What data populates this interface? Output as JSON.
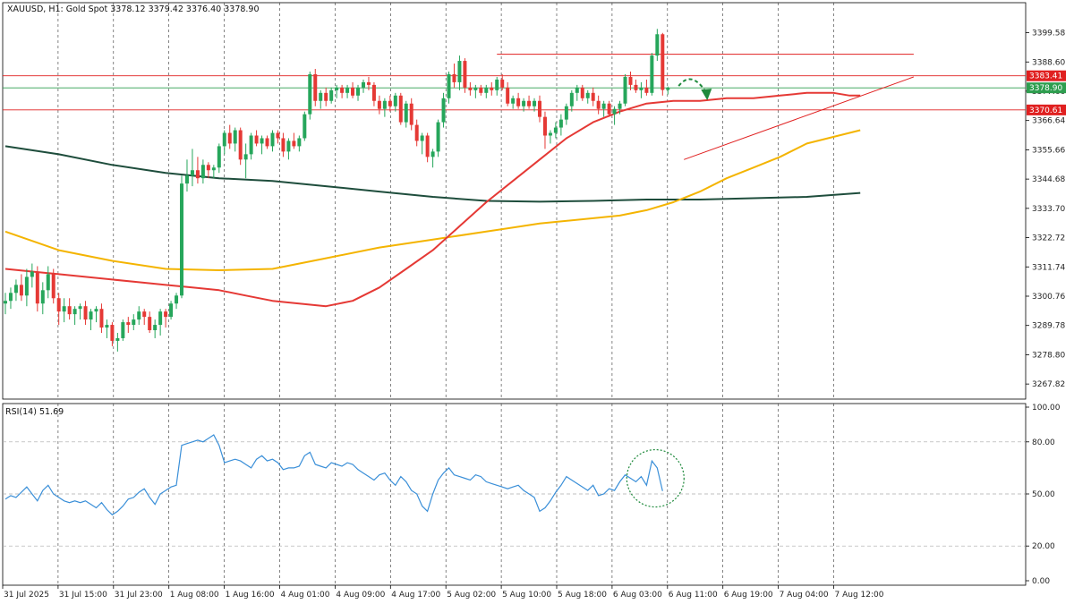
{
  "header": {
    "symbol": "XAUUSD",
    "timeframe": "H1",
    "description": "Gold Spot",
    "ohlc": [
      "3378.12",
      "3379.42",
      "3376.40",
      "3378.90"
    ]
  },
  "rsi_header": {
    "label": "RSI(14)",
    "value": "51.69"
  },
  "colors": {
    "bull": "#26a65b",
    "bear": "#e53935",
    "ma_fast": "#e53935",
    "ma_mid": "#f4b400",
    "ma_slow": "#1e4d3c",
    "rsi": "#3a8fd8",
    "level": "#e02020",
    "current": "#2e9e4f",
    "arrow": "#1f8a3c"
  },
  "chart_data": {
    "type": "candlestick",
    "time_labels": [
      "31 Jul 2025",
      "31 Jul 15:00",
      "31 Jul 23:00",
      "1 Aug 08:00",
      "1 Aug 16:00",
      "4 Aug 01:00",
      "4 Aug 09:00",
      "4 Aug 17:00",
      "5 Aug 02:00",
      "5 Aug 10:00",
      "5 Aug 18:00",
      "6 Aug 03:00",
      "6 Aug 11:00",
      "6 Aug 19:00",
      "7 Aug 04:00",
      "7 Aug 12:00"
    ],
    "price_ticks": [
      "3399.58",
      "3388.60",
      "3377.66",
      "3366.64",
      "3355.66",
      "3344.68",
      "3333.70",
      "3322.72",
      "3311.74",
      "3300.76",
      "3289.78",
      "3278.80",
      "3267.82"
    ],
    "price_range": [
      3262.5,
      3410.5
    ],
    "level_labels": [
      "3383.41",
      "3378.90",
      "3370.61"
    ],
    "levels": [
      3383.41,
      3370.61,
      3391.5
    ],
    "current_price": 3378.9,
    "rsi_ticks": [
      "100.00",
      "80.00",
      "50.00",
      "20.00",
      "0.00"
    ],
    "rsi_levels": [
      80,
      50,
      20
    ],
    "candles": [
      [
        3298.0,
        3302.0,
        3294.0,
        3299.0
      ],
      [
        3299.0,
        3304.0,
        3296.0,
        3302.0
      ],
      [
        3302.0,
        3307.0,
        3299.0,
        3305.0
      ],
      [
        3305.0,
        3309.0,
        3299.0,
        3301.0
      ],
      [
        3301.0,
        3311.0,
        3297.0,
        3308.0
      ],
      [
        3308.0,
        3313.0,
        3304.0,
        3310.0
      ],
      [
        3310.0,
        3312.0,
        3295.0,
        3298.0
      ],
      [
        3298.0,
        3306.0,
        3294.0,
        3303.0
      ],
      [
        3303.0,
        3312.0,
        3300.0,
        3309.0
      ],
      [
        3309.0,
        3311.0,
        3298.0,
        3300.0
      ],
      [
        3300.0,
        3302.0,
        3290.0,
        3295.0
      ],
      [
        3295.0,
        3300.0,
        3291.0,
        3297.0
      ],
      [
        3297.0,
        3300.0,
        3292.0,
        3294.0
      ],
      [
        3294.0,
        3297.0,
        3290.0,
        3296.0
      ],
      [
        3296.0,
        3298.0,
        3292.0,
        3297.0
      ],
      [
        3297.0,
        3299.0,
        3290.0,
        3292.0
      ],
      [
        3292.0,
        3296.0,
        3288.0,
        3295.0
      ],
      [
        3295.0,
        3297.0,
        3291.0,
        3296.0
      ],
      [
        3296.0,
        3298.0,
        3287.0,
        3289.0
      ],
      [
        3289.0,
        3292.0,
        3285.0,
        3290.0
      ],
      [
        3290.0,
        3291.0,
        3282.0,
        3284.0
      ],
      [
        3284.0,
        3287.0,
        3280.0,
        3285.0
      ],
      [
        3285.0,
        3292.0,
        3284.0,
        3291.0
      ],
      [
        3291.0,
        3293.0,
        3287.0,
        3290.0
      ],
      [
        3290.0,
        3294.0,
        3288.0,
        3292.0
      ],
      [
        3292.0,
        3297.0,
        3290.0,
        3295.0
      ],
      [
        3295.0,
        3296.0,
        3290.0,
        3293.0
      ],
      [
        3293.0,
        3295.0,
        3287.0,
        3288.0
      ],
      [
        3288.0,
        3292.0,
        3285.0,
        3290.0
      ],
      [
        3290.0,
        3296.0,
        3286.0,
        3295.0
      ],
      [
        3295.0,
        3296.0,
        3289.0,
        3293.0
      ],
      [
        3293.0,
        3299.0,
        3292.0,
        3298.0
      ],
      [
        3298.0,
        3302.0,
        3296.0,
        3301.0
      ],
      [
        3301.0,
        3346.0,
        3300.0,
        3343.0
      ],
      [
        3343.0,
        3352.0,
        3340.0,
        3346.0
      ],
      [
        3346.0,
        3356.0,
        3342.0,
        3348.0
      ],
      [
        3348.0,
        3353.0,
        3343.0,
        3345.0
      ],
      [
        3345.0,
        3352.0,
        3343.0,
        3350.0
      ],
      [
        3350.0,
        3351.0,
        3345.0,
        3348.0
      ],
      [
        3348.0,
        3350.0,
        3345.0,
        3349.0
      ],
      [
        3349.0,
        3358.0,
        3347.0,
        3357.0
      ],
      [
        3357.0,
        3363.0,
        3354.0,
        3362.0
      ],
      [
        3362.0,
        3365.0,
        3356.0,
        3358.0
      ],
      [
        3358.0,
        3364.0,
        3355.0,
        3363.0
      ],
      [
        3363.0,
        3364.0,
        3350.0,
        3352.0
      ],
      [
        3352.0,
        3358.0,
        3345.0,
        3354.0
      ],
      [
        3354.0,
        3362.0,
        3352.0,
        3361.0
      ],
      [
        3361.0,
        3363.0,
        3357.0,
        3358.0
      ],
      [
        3358.0,
        3361.0,
        3354.0,
        3360.0
      ],
      [
        3360.0,
        3361.0,
        3356.0,
        3357.0
      ],
      [
        3357.0,
        3363.0,
        3355.0,
        3362.0
      ],
      [
        3362.0,
        3363.0,
        3358.0,
        3360.0
      ],
      [
        3360.0,
        3362.0,
        3353.0,
        3355.0
      ],
      [
        3355.0,
        3360.0,
        3352.0,
        3359.0
      ],
      [
        3359.0,
        3362.0,
        3356.0,
        3357.0
      ],
      [
        3357.0,
        3361.0,
        3355.0,
        3360.0
      ],
      [
        3360.0,
        3370.0,
        3359.0,
        3369.0
      ],
      [
        3369.0,
        3385.0,
        3367.0,
        3384.0
      ],
      [
        3384.0,
        3386.0,
        3372.0,
        3374.0
      ],
      [
        3374.0,
        3378.0,
        3371.0,
        3377.0
      ],
      [
        3377.0,
        3379.0,
        3372.0,
        3374.0
      ],
      [
        3374.0,
        3379.0,
        3373.0,
        3378.0
      ],
      [
        3378.0,
        3380.0,
        3375.0,
        3379.0
      ],
      [
        3379.0,
        3380.0,
        3375.0,
        3377.0
      ],
      [
        3377.0,
        3380.0,
        3375.0,
        3379.0
      ],
      [
        3379.0,
        3381.0,
        3375.0,
        3376.0
      ],
      [
        3376.0,
        3380.0,
        3374.0,
        3379.0
      ],
      [
        3379.0,
        3382.0,
        3377.0,
        3381.0
      ],
      [
        3381.0,
        3383.0,
        3378.0,
        3380.0
      ],
      [
        3380.0,
        3381.0,
        3372.0,
        3374.0
      ],
      [
        3374.0,
        3376.0,
        3369.0,
        3371.0
      ],
      [
        3371.0,
        3375.0,
        3368.0,
        3374.0
      ],
      [
        3374.0,
        3376.0,
        3370.0,
        3372.0
      ],
      [
        3372.0,
        3377.0,
        3370.0,
        3376.0
      ],
      [
        3376.0,
        3377.0,
        3365.0,
        3366.0
      ],
      [
        3366.0,
        3374.0,
        3364.0,
        3373.0
      ],
      [
        3373.0,
        3375.0,
        3363.0,
        3365.0
      ],
      [
        3365.0,
        3367.0,
        3357.0,
        3359.0
      ],
      [
        3359.0,
        3362.0,
        3354.0,
        3361.0
      ],
      [
        3361.0,
        3362.0,
        3351.0,
        3353.0
      ],
      [
        3353.0,
        3356.0,
        3349.0,
        3355.0
      ],
      [
        3355.0,
        3367.0,
        3353.0,
        3366.0
      ],
      [
        3366.0,
        3377.0,
        3364.0,
        3375.0
      ],
      [
        3375.0,
        3385.0,
        3373.0,
        3384.0
      ],
      [
        3384.0,
        3388.0,
        3379.0,
        3381.0
      ],
      [
        3381.0,
        3391.0,
        3378.0,
        3389.0
      ],
      [
        3389.0,
        3390.0,
        3377.0,
        3379.0
      ],
      [
        3379.0,
        3381.0,
        3376.0,
        3378.0
      ],
      [
        3378.0,
        3380.0,
        3375.0,
        3379.0
      ],
      [
        3379.0,
        3380.0,
        3376.0,
        3377.0
      ],
      [
        3377.0,
        3380.0,
        3375.0,
        3379.0
      ],
      [
        3379.0,
        3381.0,
        3376.0,
        3378.0
      ],
      [
        3378.0,
        3383.0,
        3376.0,
        3382.0
      ],
      [
        3382.0,
        3384.0,
        3378.0,
        3379.0
      ],
      [
        3379.0,
        3381.0,
        3372.0,
        3373.0
      ],
      [
        3373.0,
        3376.0,
        3371.0,
        3375.0
      ],
      [
        3375.0,
        3377.0,
        3371.0,
        3372.0
      ],
      [
        3372.0,
        3375.0,
        3370.0,
        3374.0
      ],
      [
        3374.0,
        3376.0,
        3371.0,
        3372.0
      ],
      [
        3372.0,
        3375.0,
        3370.0,
        3374.0
      ],
      [
        3374.0,
        3376.0,
        3366.0,
        3368.0
      ],
      [
        3368.0,
        3370.0,
        3356.0,
        3361.0
      ],
      [
        3361.0,
        3363.0,
        3358.0,
        3362.0
      ],
      [
        3362.0,
        3366.0,
        3360.0,
        3364.0
      ],
      [
        3364.0,
        3369.0,
        3361.0,
        3367.0
      ],
      [
        3367.0,
        3373.0,
        3365.0,
        3372.0
      ],
      [
        3372.0,
        3378.0,
        3370.0,
        3377.0
      ],
      [
        3377.0,
        3380.0,
        3374.0,
        3379.0
      ],
      [
        3379.0,
        3380.0,
        3374.0,
        3375.0
      ],
      [
        3375.0,
        3378.0,
        3373.0,
        3377.0
      ],
      [
        3377.0,
        3379.0,
        3372.0,
        3374.0
      ],
      [
        3374.0,
        3376.0,
        3369.0,
        3371.0
      ],
      [
        3371.0,
        3374.0,
        3368.0,
        3373.0
      ],
      [
        3373.0,
        3374.0,
        3368.0,
        3369.0
      ],
      [
        3369.0,
        3372.0,
        3365.0,
        3371.0
      ],
      [
        3371.0,
        3374.0,
        3369.0,
        3373.0
      ],
      [
        3373.0,
        3384.0,
        3372.0,
        3383.0
      ],
      [
        3383.0,
        3385.0,
        3378.0,
        3380.0
      ],
      [
        3380.0,
        3382.0,
        3377.0,
        3378.0
      ],
      [
        3378.0,
        3381.0,
        3375.0,
        3379.0
      ],
      [
        3379.0,
        3382.0,
        3376.0,
        3377.0
      ],
      [
        3377.0,
        3392.0,
        3376.0,
        3391.0
      ],
      [
        3391.0,
        3401.0,
        3389.0,
        3399.0
      ],
      [
        3399.0,
        3399.5,
        3376.0,
        3378.1
      ],
      [
        3378.1,
        3379.4,
        3376.4,
        3378.9
      ]
    ],
    "ma_fast": [
      3311.0,
      3310.0,
      3309.0,
      3308.0,
      3307.0,
      3306.0,
      3305.0,
      3304.0,
      3303.0,
      3301.0,
      3299.0,
      3298.0,
      3297.0,
      3299.0,
      3304.0,
      3311.0,
      3318.0,
      3327.0,
      3336.0,
      3344.0,
      3352.0,
      3360.0,
      3366.0,
      3370.0,
      3373.0,
      3374.0,
      3374.0,
      3375.0,
      3375.0,
      3376.0,
      3377.0,
      3377.0,
      3376.0,
      3376.0
    ],
    "ma_fast_x": [
      0,
      5,
      10,
      15,
      20,
      25,
      30,
      35,
      40,
      45,
      50,
      55,
      60,
      65,
      70,
      75,
      80,
      85,
      90,
      95,
      100,
      105,
      110,
      115,
      120,
      125,
      130,
      135,
      140,
      145,
      150,
      155,
      158,
      160
    ],
    "ma_mid": [
      3325.0,
      3318.0,
      3314.0,
      3311.0,
      3310.5,
      3311.0,
      3315.0,
      3319.0,
      3322.0,
      3325.0,
      3328.0,
      3330.0,
      3331.0,
      3333.0,
      3336.0,
      3340.0,
      3345.0,
      3349.0,
      3353.0,
      3358.0,
      3363.0
    ],
    "ma_mid_x": [
      0,
      10,
      20,
      30,
      40,
      50,
      60,
      70,
      80,
      90,
      100,
      110,
      115,
      120,
      125,
      130,
      135,
      140,
      145,
      150,
      160
    ],
    "ma_slow": [
      3357.0,
      3354.0,
      3350.0,
      3347.0,
      3345.0,
      3344.0,
      3342.0,
      3340.0,
      3338.0,
      3336.5,
      3336.2,
      3336.5,
      3337.0,
      3337.0,
      3337.5,
      3338.0,
      3339.5
    ],
    "ma_slow_x": [
      0,
      10,
      20,
      30,
      40,
      50,
      60,
      70,
      80,
      90,
      100,
      110,
      120,
      130,
      140,
      150,
      160
    ],
    "rsi_values": [
      47,
      49,
      48,
      51,
      54,
      50,
      46,
      52,
      55,
      50,
      48,
      46,
      45,
      46,
      45,
      46,
      44,
      42,
      45,
      41,
      38,
      40,
      43,
      47,
      48,
      51,
      53,
      48,
      44,
      50,
      52,
      54,
      55,
      78,
      79,
      80,
      81,
      80,
      82,
      84,
      78,
      68,
      69,
      70,
      69,
      67,
      65,
      70,
      72,
      69,
      70,
      68,
      64,
      65,
      65,
      66,
      72,
      74,
      67,
      66,
      65,
      68,
      67,
      66,
      68,
      67,
      64,
      62,
      60,
      58,
      61,
      62,
      58,
      55,
      60,
      57,
      52,
      50,
      43,
      40,
      50,
      58,
      62,
      65,
      61,
      60,
      59,
      58,
      61,
      60,
      57,
      56,
      55,
      54,
      53,
      54,
      55,
      52,
      50,
      48,
      40,
      42,
      46,
      51,
      55,
      60,
      58,
      56,
      54,
      52,
      55,
      49,
      50,
      53,
      52,
      57,
      61,
      59,
      57,
      60,
      55,
      69,
      65,
      51.69
    ],
    "trendline": [
      [
        127,
        3352.0
      ],
      [
        170,
        3383.0
      ]
    ],
    "resistance_span": [
      92,
      170
    ]
  }
}
